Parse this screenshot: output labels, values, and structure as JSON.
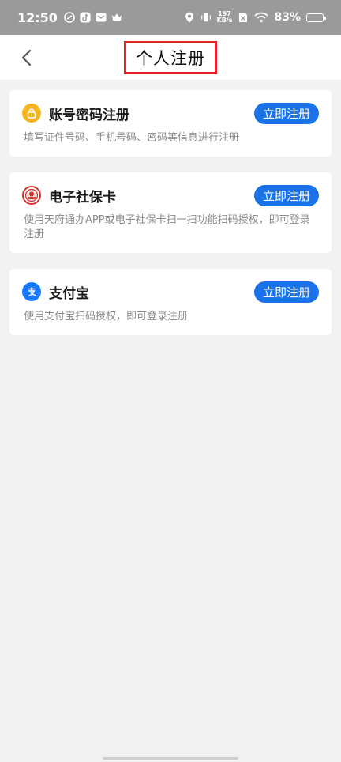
{
  "status_bar": {
    "time": "12:50",
    "net_speed_value": "197",
    "net_speed_unit": "KB/s",
    "battery": "83%",
    "battery_level": 0.83
  },
  "header": {
    "title": "个人注册"
  },
  "options": [
    {
      "icon": "lock-icon",
      "icon_color": "#f5b51d",
      "title": "账号密码注册",
      "button": "立即注册",
      "description": "填写证件号码、手机号码、密码等信息进行注册"
    },
    {
      "icon": "social-security-card-icon",
      "icon_color": "#d6302a",
      "title": "电子社保卡",
      "button": "立即注册",
      "description": "使用天府通办APP或电子社保卡扫一扫功能扫码授权，即可登录注册"
    },
    {
      "icon": "alipay-icon",
      "icon_color": "#1677ff",
      "title": "支付宝",
      "button": "立即注册",
      "description": "使用支付宝扫码授权，即可登录注册"
    }
  ],
  "colors": {
    "primary_button": "#1a72e8",
    "highlight_border": "#e0202a",
    "status_bar_bg": "#9a9a9a",
    "page_bg": "#f2f2f2"
  }
}
